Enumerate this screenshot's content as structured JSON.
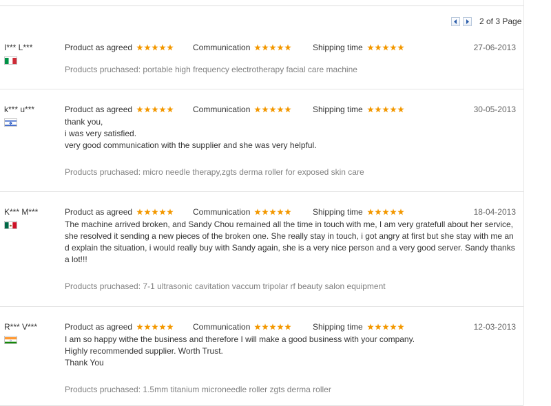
{
  "pager": {
    "text": "2 of 3 Page"
  },
  "rating_labels": {
    "product": "Product as agreed",
    "communication": "Communication",
    "shipping": "Shipping time"
  },
  "colors": {
    "star": "#f39800",
    "divider": "#e3e3e3"
  },
  "reviews": [
    {
      "buyer": "I*** L***",
      "country_flag": "italy-flag",
      "date": "27-06-2013",
      "stars": {
        "product": 5,
        "communication": 5,
        "shipping": 5
      },
      "comment": [],
      "purchased": "Products pruchased: portable high frequency electrotherapy facial care machine"
    },
    {
      "buyer": "k*** u***",
      "country_flag": "israel-flag",
      "date": "30-05-2013",
      "stars": {
        "product": 5,
        "communication": 5,
        "shipping": 5
      },
      "comment": [
        "thank you,",
        "i was very satisfied.",
        "very good communication with the supplier and she was very helpful."
      ],
      "purchased": "Products pruchased: micro needle therapy,zgts derma roller for exposed skin care"
    },
    {
      "buyer": "K*** M***",
      "country_flag": "mexico-flag",
      "date": "18-04-2013",
      "stars": {
        "product": 5,
        "communication": 5,
        "shipping": 5
      },
      "comment": [
        "The machine arrived broken, and Sandy Chou remained all the time in touch with me, I am very gratefull about her service, she resolved it sending a new pieces of the broken one. She really stay in touch, i got angry at first but she stay with me and explain the situation, i would really buy with Sandy again, she is a very nice person and a very good server. Sandy thanks a lot!!!"
      ],
      "purchased": "Products pruchased: 7-1 ultrasonic cavitation vaccum tripolar rf beauty salon equipment"
    },
    {
      "buyer": "R*** V***",
      "country_flag": "india-flag",
      "date": "12-03-2013",
      "stars": {
        "product": 5,
        "communication": 5,
        "shipping": 5
      },
      "comment": [
        "I am so happy withe the business and therefore I will make a good business with your company.",
        "Highly recommended supplier. Worth Trust.",
        "Thank You"
      ],
      "purchased": "Products pruchased: 1.5mm titanium microneedle roller zgts derma roller"
    }
  ]
}
